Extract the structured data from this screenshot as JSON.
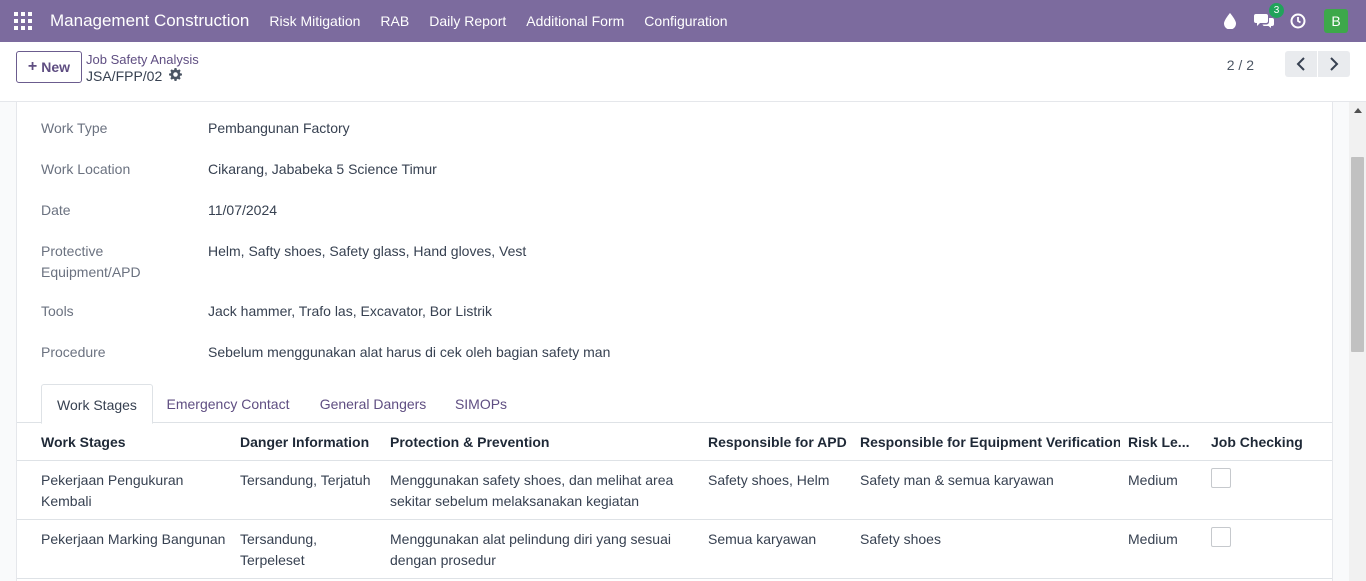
{
  "navbar": {
    "brand": "Management Construction",
    "menu": [
      "Risk Mitigation",
      "RAB",
      "Daily Report",
      "Additional Form",
      "Configuration"
    ],
    "messages_count": "3",
    "avatar_letter": "B"
  },
  "control": {
    "new_label": "New",
    "breadcrumb": "Job Safety Analysis",
    "record_name": "JSA/FPP/02",
    "pager": "2 / 2"
  },
  "fields": [
    {
      "label": "Work Type",
      "value": "Pembangunan Factory"
    },
    {
      "label": "Work Location",
      "value": "Cikarang, Jababeka 5 Science Timur"
    },
    {
      "label": "Date",
      "value": "11/07/2024"
    },
    {
      "label": "Protective Equipment/APD",
      "value": "Helm, Safty shoes, Safety glass, Hand gloves, Vest"
    },
    {
      "label": "Tools",
      "value": "Jack hammer, Trafo las, Excavator, Bor Listrik"
    },
    {
      "label": "Procedure",
      "value": "Sebelum menggunakan alat harus di cek oleh bagian safety man"
    }
  ],
  "tabs": [
    "Work Stages",
    "Emergency Contact",
    "General Dangers",
    "SIMOPs"
  ],
  "table": {
    "headers": [
      "Work Stages",
      "Danger Information",
      "Protection & Prevention",
      "Responsible for APD",
      "Responsible for Equipment Verification",
      "Risk Le...",
      "Job Checking"
    ],
    "rows": [
      [
        "Pekerjaan Pengukuran Kembali",
        "Tersandung, Terjatuh",
        "Menggunakan safety shoes, dan melihat area sekitar sebelum melaksanakan kegiatan",
        "Safety shoes, Helm",
        "Safety man & semua karyawan",
        "Medium"
      ],
      [
        "Pekerjaan Marking Bangunan",
        "Tersandung, Terpeleset",
        "Menggunakan alat pelindung diri yang sesuai dengan prosedur",
        "Semua karyawan",
        "Safety shoes",
        "Medium"
      ]
    ]
  },
  "colors": {
    "navbar": "#7c6b9e",
    "accent": "#5f4e82",
    "badge": "#21a35b",
    "avatar": "#3da84a"
  }
}
